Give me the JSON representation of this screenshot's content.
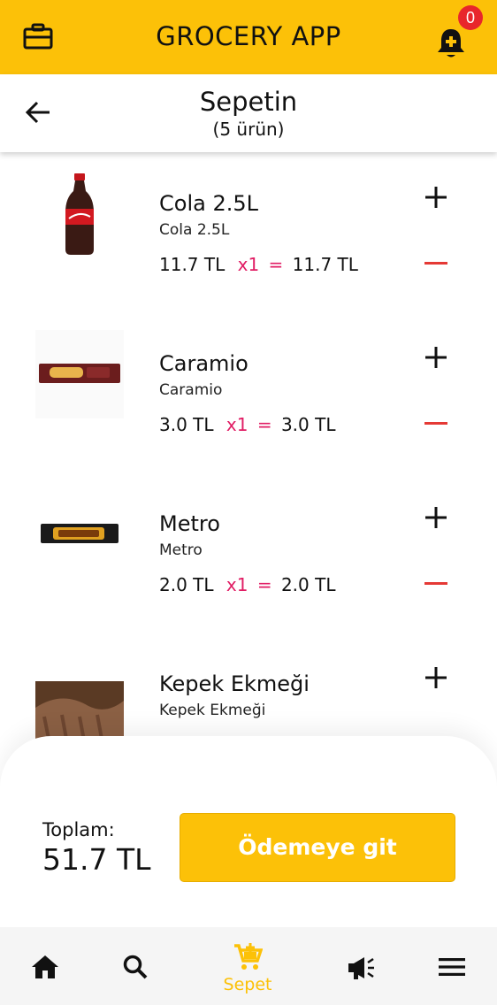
{
  "app": {
    "title": "GROCERY APP",
    "notification_count": "0",
    "accent_color": "#fcc108",
    "badge_color": "#e8262b"
  },
  "header": {
    "title": "Sepetin",
    "subtitle": "(5 ürün)"
  },
  "cart": {
    "items": [
      {
        "name": "Cola 2.5L",
        "subtitle": "Cola 2.5L",
        "unit_price": "11.7 TL",
        "qty": "x1",
        "eq": "=",
        "total": "11.7 TL",
        "image_icon": "cola-bottle"
      },
      {
        "name": "Caramio",
        "subtitle": "Caramio",
        "unit_price": "3.0 TL",
        "qty": "x1",
        "eq": "=",
        "total": "3.0 TL",
        "image_icon": "caramio-bar"
      },
      {
        "name": "Metro",
        "subtitle": "Metro",
        "unit_price": "2.0 TL",
        "qty": "x1",
        "eq": "=",
        "total": "2.0 TL",
        "image_icon": "metro-bar"
      },
      {
        "name": "Kepek Ekmeği",
        "subtitle": "Kepek Ekmeği",
        "unit_price": "",
        "qty": "",
        "eq": "",
        "total": "",
        "image_icon": "bran-bread"
      }
    ]
  },
  "checkout": {
    "total_label": "Toplam:",
    "total_value": "51.7 TL",
    "button_label": "Ödemeye git"
  },
  "nav": {
    "items": [
      {
        "icon": "home-icon",
        "label": ""
      },
      {
        "icon": "search-icon",
        "label": ""
      },
      {
        "icon": "cart-icon",
        "label": "Sepet",
        "active": true
      },
      {
        "icon": "megaphone-icon",
        "label": ""
      },
      {
        "icon": "menu-icon",
        "label": ""
      }
    ]
  }
}
